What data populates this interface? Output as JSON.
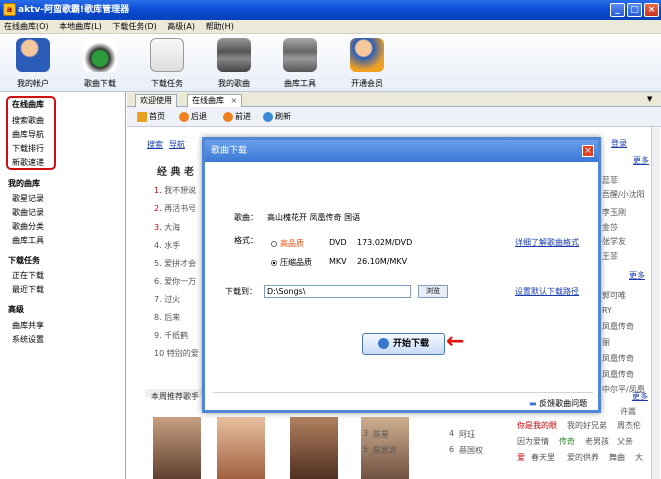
{
  "window": {
    "title": "aktv-阿蛮歌霸!歌库管理器"
  },
  "menu": [
    "在线曲库(O)",
    "本地曲库(L)",
    "下载任务(D)",
    "高级(A)",
    "帮助(H)"
  ],
  "toolbar": [
    {
      "label": "我的帐户",
      "icon": "user-icon"
    },
    {
      "label": "歌曲下载",
      "icon": "headphones-download-icon"
    },
    {
      "label": "下载任务",
      "icon": "download-task-icon"
    },
    {
      "label": "我的歌曲",
      "icon": "database-icon"
    },
    {
      "label": "曲库工具",
      "icon": "database-tools-icon"
    },
    {
      "label": "开通会员",
      "icon": "vip-member-icon"
    }
  ],
  "sidebar": {
    "online": {
      "title": "在线曲库",
      "items": [
        "搜索歌曲",
        "曲库导航",
        "下载排行",
        "新歌速递"
      ]
    },
    "mine": {
      "title": "我的曲库",
      "items": [
        "歌星记录",
        "歌曲记录",
        "歌曲分类",
        "曲库工具"
      ]
    },
    "download": {
      "title": "下载任务",
      "items": [
        "正在下载",
        "最近下载"
      ]
    },
    "advanced": {
      "title": "高级",
      "items": [
        "曲库共享",
        "系统设置"
      ]
    }
  },
  "tabs": [
    "欢迎使用",
    "在线曲库"
  ],
  "nav": [
    "首页",
    "后退",
    "前进",
    "刷新"
  ],
  "background": {
    "header_links": [
      "搜索",
      "导航"
    ],
    "top_links": [
      "登录",
      "更多"
    ],
    "section_title": "经 典 老",
    "list": [
      "我不想说",
      "再活书号",
      "大海",
      "水手",
      "爱拼才会",
      "爱你一万",
      "过火",
      "后来",
      "千纸鹤",
      "特别的爱"
    ],
    "right_col": [
      "更多",
      "蕊菲",
      "吾醒/小沈阳",
      "李玉刚",
      "金莎",
      "张学友",
      "王菲",
      "更多",
      "郭可唯",
      "RY",
      "凤凰传奇",
      "丽",
      "凤凰传奇",
      "黄耀明",
      "凤凰传奇",
      "凤凰传奇",
      "中尔平/凤凰"
    ],
    "bottom_title": "本周推荐歌手",
    "bottom_names": [
      "陈星",
      "阿珏",
      "陈思思",
      "蔡国权"
    ],
    "bottom_right": [
      "更多",
      "许嵩",
      "你是我的眼",
      "我的好兄弟",
      "周杰伦",
      "因为爱情",
      "传奇",
      "老男孩",
      "父亲",
      "爱",
      "春天里",
      "爱的供养",
      "舞曲",
      "大"
    ],
    "bottom_nums": [
      "3",
      "4",
      "5",
      "6"
    ]
  },
  "dialog": {
    "title": "歌曲下载",
    "song_label": "歌曲：",
    "song_value": "高山槐花开 凤凰传奇 国语",
    "format_label": "格式：",
    "hq": {
      "name": "高品质",
      "type": "DVD",
      "size": "173.02M/DVD"
    },
    "cq": {
      "name": "压缩品质",
      "type": "MKV",
      "size": "26.10M/MKV"
    },
    "format_link": "详细了解歌曲格式",
    "download_to_label": "下载到：",
    "path": "D:\\Songs\\",
    "browse": "浏览",
    "default_path_link": "设置默认下载路径",
    "start": "开始下载",
    "feedback": "反馈歌曲问题"
  },
  "colors": {
    "titlebar": "#0a4bd4",
    "highlight": "#d01010",
    "dialog_head": "#3b78d6"
  }
}
